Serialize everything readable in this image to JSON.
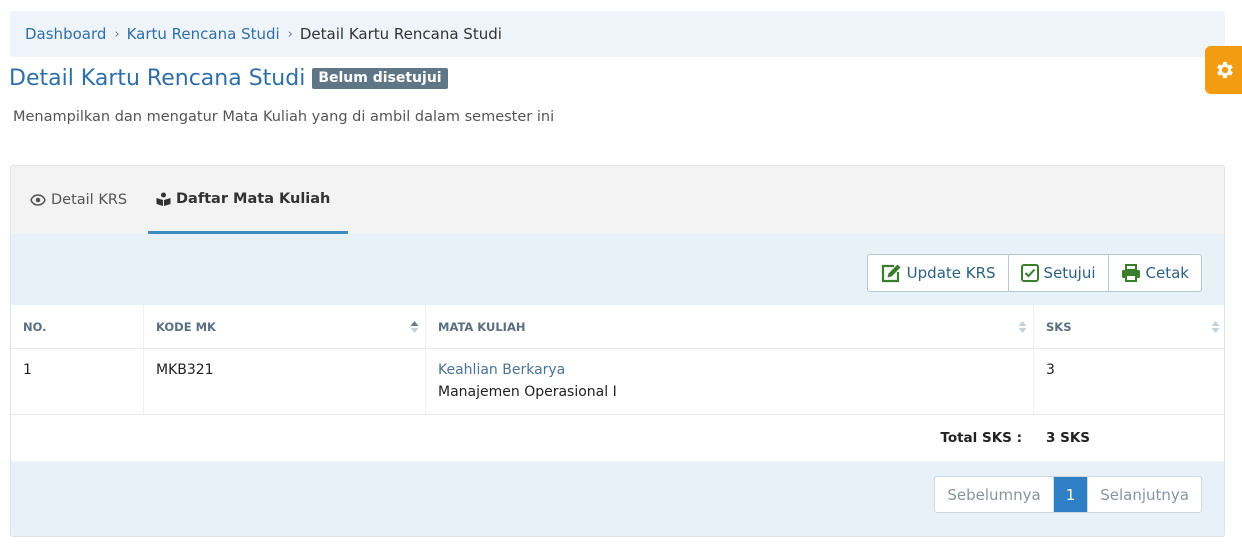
{
  "breadcrumb": {
    "items": [
      "Dashboard",
      "Kartu Rencana Studi",
      "Detail Kartu Rencana Studi"
    ]
  },
  "page": {
    "title": "Detail Kartu Rencana Studi",
    "status_badge": "Belum disetujui",
    "subtitle": "Menampilkan dan mengatur Mata Kuliah yang di ambil dalam semester ini"
  },
  "tabs": [
    {
      "label": "Detail KRS",
      "icon": "eye-icon"
    },
    {
      "label": "Daftar Mata Kuliah",
      "icon": "reading-icon",
      "active": true
    }
  ],
  "toolbar": {
    "update_label": "Update KRS",
    "approve_label": "Setujui",
    "print_label": "Cetak"
  },
  "table": {
    "headers": {
      "no": "NO.",
      "kode": "KODE MK",
      "mk": "MATA KULIAH",
      "sks": "SKS"
    },
    "rows": [
      {
        "no": "1",
        "kode": "MKB321",
        "group": "Keahlian Berkarya",
        "name": "Manajemen Operasional I",
        "sks": "3"
      }
    ],
    "total_label": "Total SKS :",
    "total_value": "3 SKS"
  },
  "pagination": {
    "prev": "Sebelumnya",
    "current": "1",
    "next": "Selanjutnya"
  },
  "colors": {
    "accent": "#2f6fa7",
    "settings_tab": "#f39c12",
    "badge": "#5f7686",
    "active_page": "#2f7fc5"
  }
}
